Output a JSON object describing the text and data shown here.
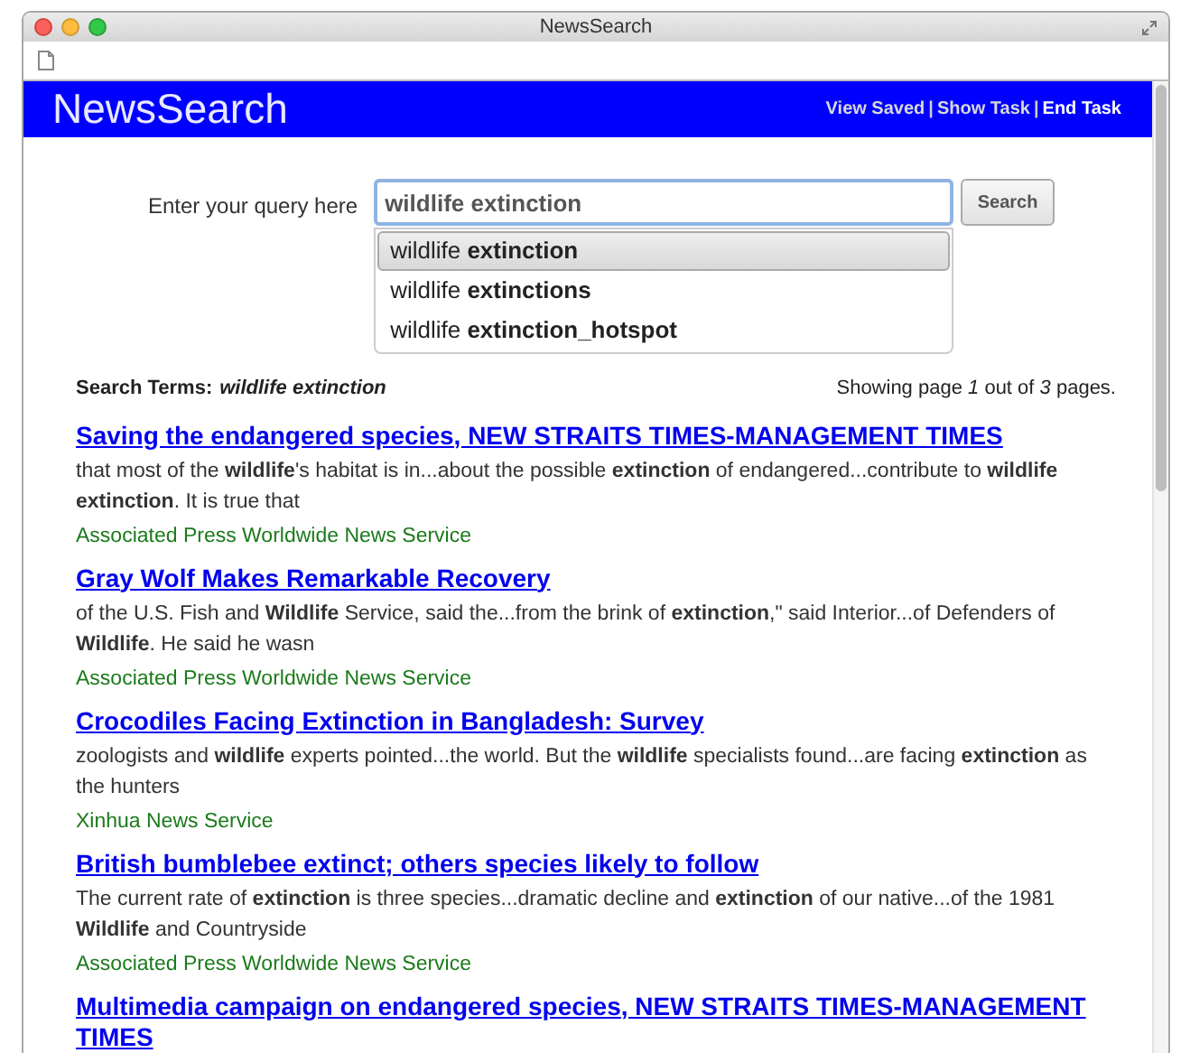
{
  "window": {
    "title": "NewsSearch"
  },
  "header": {
    "logo": "NewsSearch",
    "separator": "|",
    "links": [
      {
        "label": "View Saved",
        "selected": false
      },
      {
        "label": "Show Task",
        "selected": false
      },
      {
        "label": "End Task",
        "selected": true
      }
    ]
  },
  "search": {
    "label": "Enter your query here",
    "value": "wildlife extinction",
    "button": "Search",
    "suggestions": [
      {
        "text": "wildlife **extinction**",
        "selected": true
      },
      {
        "text": "wildlife **extinctions**",
        "selected": false
      },
      {
        "text": "wildlife **extinction_hotspot**",
        "selected": false
      }
    ]
  },
  "summary": {
    "label": "Search Terms:",
    "terms": "wildlife extinction",
    "paging": "Showing page *1* out of *3* pages."
  },
  "results": [
    {
      "title": "Saving the endangered species, NEW STRAITS TIMES-MANAGEMENT TIMES",
      "snippet": "that most of the **wildlife**'s habitat is in...about the possible **extinction** of endangered...contribute to **wildlife extinction**. It is true that",
      "source": "Associated Press Worldwide News Service"
    },
    {
      "title": "Gray Wolf Makes Remarkable Recovery",
      "snippet": "of the U.S. Fish and **Wildlife** Service, said the...from the brink of **extinction**,\" said Interior...of Defenders of **Wildlife**. He said he wasn",
      "source": "Associated Press Worldwide News Service"
    },
    {
      "title": "Crocodiles Facing Extinction in Bangladesh: Survey",
      "snippet": "zoologists and **wildlife** experts pointed...the world. But the **wildlife** specialists found...are facing **extinction** as the hunters",
      "source": "Xinhua News Service"
    },
    {
      "title": "British bumblebee extinct; others species likely to follow",
      "snippet": "The current rate of **extinction** is three species...dramatic decline and **extinction** of our native...of the 1981 **Wildlife** and Countryside",
      "source": "Associated Press Worldwide News Service"
    },
    {
      "title": "Multimedia campaign on endangered species, NEW STRAITS TIMES-MANAGEMENT TIMES"
    }
  ]
}
